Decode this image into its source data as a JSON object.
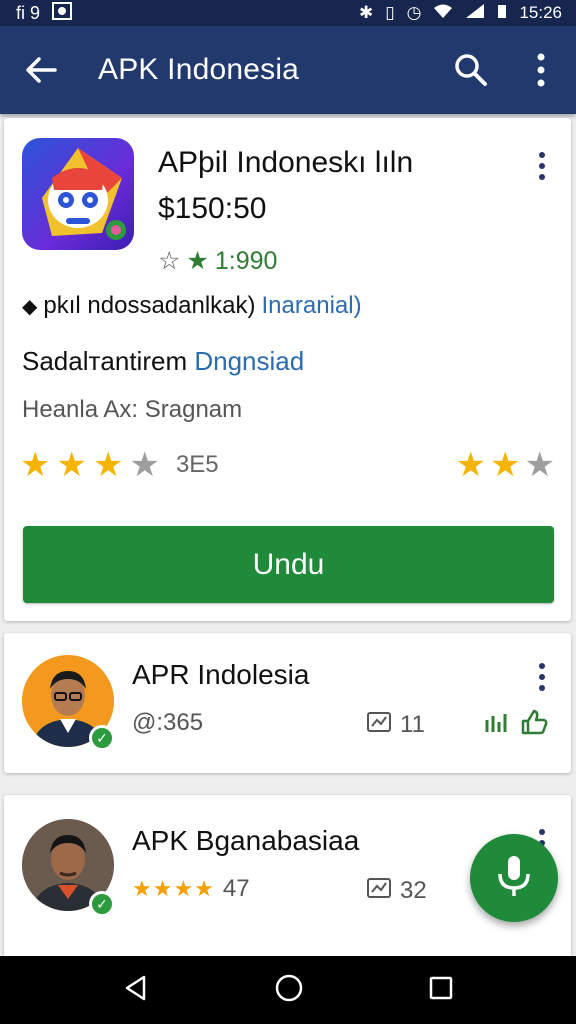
{
  "status_bar": {
    "left": "fi 9",
    "time": "15:26"
  },
  "app_bar": {
    "title": "APK Indonesia"
  },
  "main_card": {
    "app_name": "APþil Indoneskı lıln",
    "price": "$150:50",
    "rating": "1:990",
    "line1_text": "pkıl ndossadanlkak)",
    "line1_link": "Inaranial)",
    "line2_text": "Sadalтantirem",
    "line2_link": "Dngnsiad",
    "line3_text": "Heanla Ax: Sragnam",
    "stars_count": "3E5",
    "star_rating": 3,
    "star_rating_right": 2,
    "download_label": "Undu"
  },
  "list_items": [
    {
      "title": "APR Indolesia",
      "meta_left": "@:365",
      "meta_mid": "11"
    },
    {
      "title": "APK Bganabasiaa",
      "meta_left": "47",
      "meta_mid": "32"
    }
  ],
  "colors": {
    "status_bar": "#17264f",
    "app_bar": "#22396e",
    "accent_green": "#1e8a3a",
    "star": "#f5b400",
    "link_blue": "#2b6cb0"
  },
  "icons": {
    "app_bar": [
      "back-arrow-icon",
      "search-icon",
      "more-vert-icon"
    ],
    "nav_bar": [
      "back-triangle-icon",
      "home-circle-icon",
      "recents-square-icon"
    ],
    "fab": "microphone-icon"
  }
}
